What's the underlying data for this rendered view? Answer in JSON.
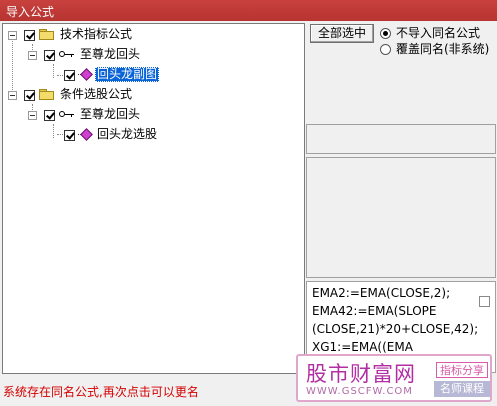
{
  "window": {
    "title": "导入公式"
  },
  "tree": {
    "groups": [
      {
        "label": "技术指标公式",
        "checked": true,
        "items": [
          {
            "label": "至尊龙回头",
            "checked": true,
            "children": [
              {
                "label": "回头龙副图",
                "checked": true,
                "selected": true
              }
            ]
          }
        ]
      },
      {
        "label": "条件选股公式",
        "checked": true,
        "items": [
          {
            "label": "至尊龙回头",
            "checked": true,
            "children": [
              {
                "label": "回头龙选股",
                "checked": true,
                "selected": false
              }
            ]
          }
        ]
      }
    ]
  },
  "controls": {
    "select_all_label": "全部选中",
    "options": [
      {
        "label": "不导入同名公式",
        "selected": true
      },
      {
        "label": "覆盖同名(非系统)",
        "selected": false
      }
    ]
  },
  "formula_preview": {
    "lines": [
      "EMA2:=EMA(CLOSE,2);",
      "EMA42:=EMA(SLOPE",
      "(CLOSE,21)*20+CLOSE,42);",
      "XG1:=EMA((EMA"
    ]
  },
  "status": {
    "message": "系统存在同名公式,再次点击可以更名"
  },
  "watermark": {
    "site_name": "股市财富网",
    "url": "WWW.GSCFW.COM",
    "tag1": "指标分享",
    "tag2": "名师课程"
  },
  "colors": {
    "title_bar": "#c0504d",
    "selection": "#0a64d8",
    "status_text": "#d40000"
  }
}
